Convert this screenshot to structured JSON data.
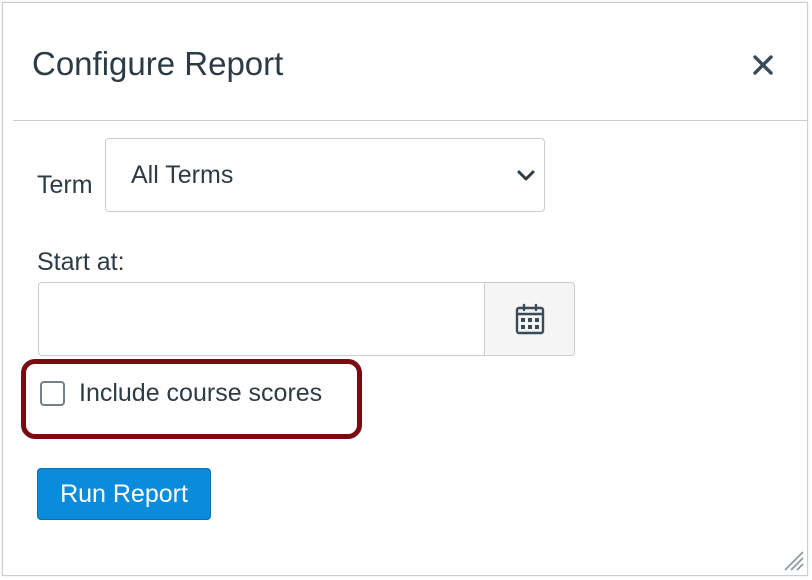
{
  "dialog": {
    "title": "Configure Report",
    "close_icon": "close-icon"
  },
  "form": {
    "term_label": "Term",
    "term_selected": "All Terms",
    "start_label": "Start at:",
    "start_value": "",
    "calendar_icon": "calendar-icon",
    "include_scores_label": "Include course scores",
    "include_scores_checked": false,
    "highlight_color": "#7a0a12"
  },
  "actions": {
    "run_label": "Run Report",
    "run_color": "#0b8bdc"
  }
}
